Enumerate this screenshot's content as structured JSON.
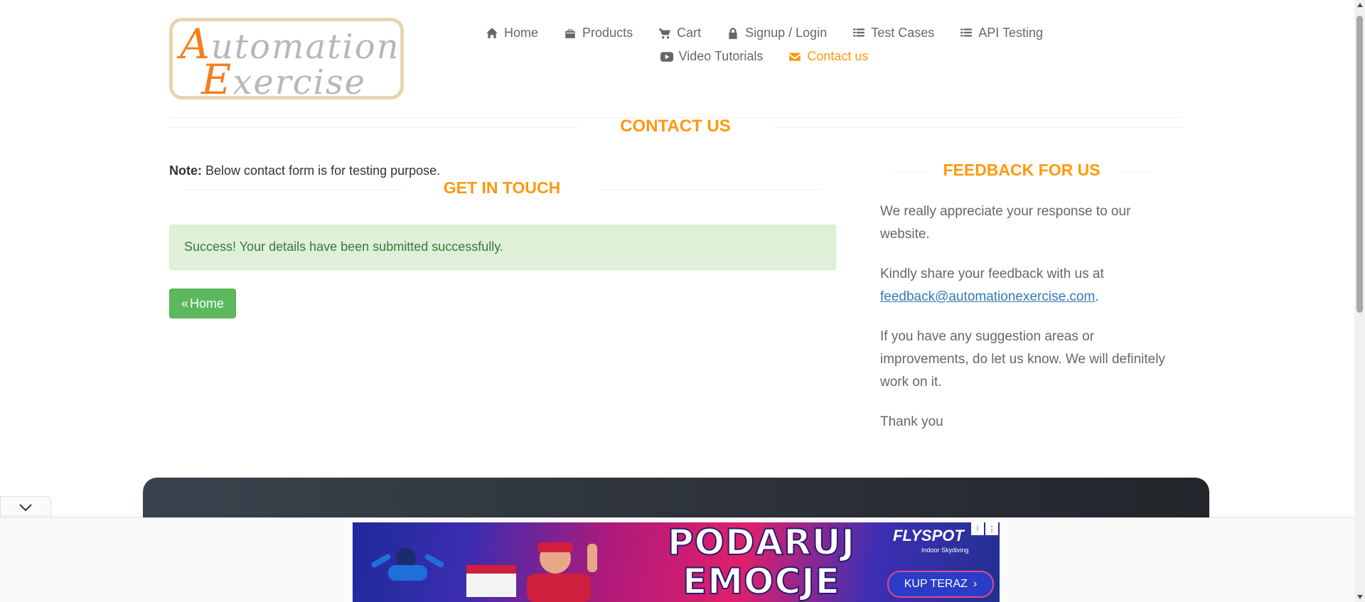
{
  "logo": {
    "line1_cap": "A",
    "line1_rest": "utomation",
    "line2_cap": "E",
    "line2_rest": "xercise"
  },
  "nav": {
    "row1": [
      {
        "label": "Home",
        "icon": "home-icon"
      },
      {
        "label": "Products",
        "icon": "briefcase-icon"
      },
      {
        "label": "Cart",
        "icon": "cart-icon"
      },
      {
        "label": "Signup / Login",
        "icon": "lock-icon"
      },
      {
        "label": "Test Cases",
        "icon": "list-icon"
      },
      {
        "label": "API Testing",
        "icon": "list-icon"
      }
    ],
    "row2": [
      {
        "label": "Video Tutorials",
        "icon": "youtube-icon"
      },
      {
        "label": "Contact us",
        "icon": "envelope-icon",
        "active": true
      }
    ]
  },
  "contact": {
    "title": "CONTACT US",
    "note_label": "Note:",
    "note_text": " Below contact form is for testing purpose.",
    "get_in_touch": "GET IN TOUCH",
    "success_message": "Success! Your details have been submitted successfully.",
    "home_button": "Home"
  },
  "feedback": {
    "title": "FEEDBACK FOR US",
    "p1": "We really appreciate your response to our website.",
    "p2_prefix": "Kindly share your feedback with us at ",
    "p2_email": "feedback@automationexercise.com",
    "p2_suffix": ".",
    "p3": "If you have any suggestion areas or improvements, do let us know. We will definitely work on it.",
    "p4": "Thank you"
  },
  "ad": {
    "line1": "PODARUJ",
    "line2": "EMOCJE",
    "brand": "FLYSPOT",
    "sub": "Indoor Skydiving",
    "cta": "KUP TERAZ",
    "badge_i": "i",
    "badge_menu": "⋮"
  },
  "colors": {
    "accent": "#fe980f",
    "success_bg": "#dff0d8",
    "success_text": "#3c763d",
    "button_green": "#5cb85c"
  }
}
